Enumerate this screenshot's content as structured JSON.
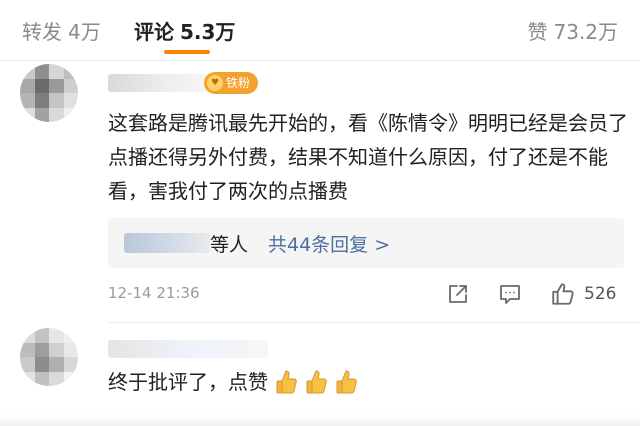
{
  "tabs": {
    "repost": {
      "label": "转发",
      "count": "4万"
    },
    "comment": {
      "label": "评论",
      "count": "5.3万"
    },
    "like": {
      "label": "赞",
      "count": "73.2万"
    }
  },
  "colors": {
    "accent": "#ff8200",
    "link": "#4d6f9d",
    "badge": "#f4a12f"
  },
  "comments": [
    {
      "badge": "铁粉",
      "text": "这套路是腾讯最先开始的，看《陈情令》明明已经是会员了点播还得另外付费，结果不知道什么原因，付了还是不能看，害我付了两次的点播费",
      "replies": {
        "suffix": "等人",
        "link": "共44条回复 >"
      },
      "time": "12-14 21:36",
      "likes": "526"
    },
    {
      "text": "终于批评了，点赞"
    }
  ],
  "icons": {
    "share": "share-icon",
    "comment": "comment-icon",
    "like": "thumbs-up-icon",
    "emoji": "thumbs-up-emoji-icon"
  }
}
